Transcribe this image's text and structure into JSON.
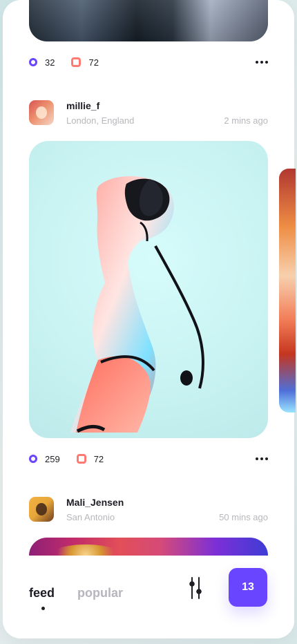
{
  "posts": [
    {
      "image_desc": "top-image",
      "stats": {
        "circle_count": "32",
        "square_count": "72"
      }
    },
    {
      "username": "millie_f",
      "location": "London, England",
      "time": "2 mins ago",
      "stats": {
        "circle_count": "259",
        "square_count": "72"
      }
    },
    {
      "username": "Mali_Jensen",
      "location": "San Antonio",
      "time": "50 mins ago"
    }
  ],
  "nav": {
    "feed": "feed",
    "popular": "popular",
    "badge": "13"
  },
  "colors": {
    "accent": "#6a45ff",
    "secondary": "#ff7a70"
  },
  "icons": {
    "more": "more-icon",
    "filter": "filter-icon",
    "circle": "circle-icon",
    "square": "square-icon"
  }
}
